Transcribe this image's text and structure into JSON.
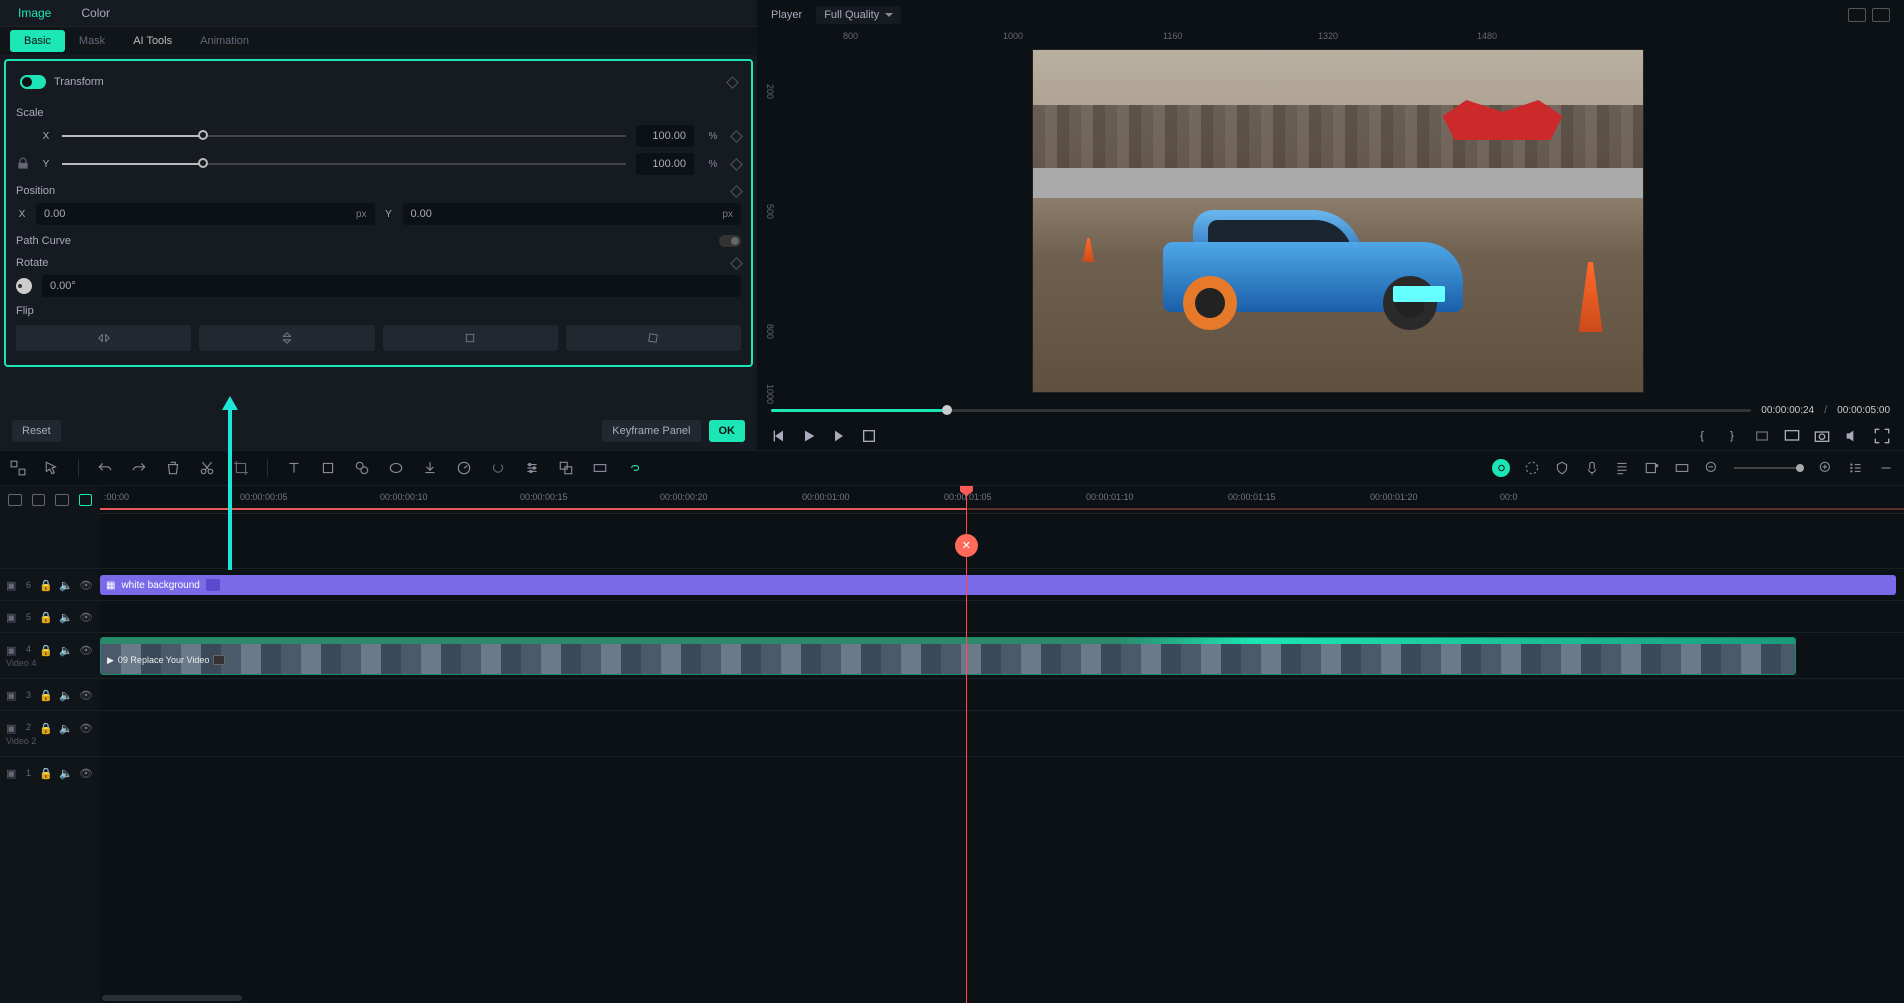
{
  "mainTabs": {
    "image": "Image",
    "color": "Color"
  },
  "subTabs": {
    "basic": "Basic",
    "mask": "Mask",
    "aiTools": "AI Tools",
    "animation": "Animation"
  },
  "inspector": {
    "transform": "Transform",
    "scale": "Scale",
    "scaleX": {
      "label": "X",
      "value": "100.00",
      "unit": "%"
    },
    "scaleY": {
      "label": "Y",
      "value": "100.00",
      "unit": "%"
    },
    "position": "Position",
    "posX": {
      "label": "X",
      "value": "0.00",
      "unit": "px"
    },
    "posY": {
      "label": "Y",
      "value": "0.00",
      "unit": "px"
    },
    "pathCurve": "Path Curve",
    "rotate": "Rotate",
    "rotateValue": "0.00°",
    "flip": "Flip"
  },
  "buttons": {
    "reset": "Reset",
    "keyframePanel": "Keyframe Panel",
    "ok": "OK"
  },
  "player": {
    "title": "Player",
    "quality": "Full Quality",
    "rulerH": [
      "800",
      "1000",
      "1160",
      "1320",
      "1480"
    ],
    "rulerV": [
      "200",
      "500",
      "800",
      "1000"
    ],
    "currentTime": "00:00:00:24",
    "totalTime": "00:00:05:00",
    "markL": "{",
    "markR": "}"
  },
  "timeline": {
    "ruler": [
      ":00:00",
      "00:00:00:05",
      "00:00:00:10",
      "00:00:00:15",
      "00:00:00:20",
      "00:00:01:00",
      "00:00:01:05",
      "00:00:01:10",
      "00:00:01:15",
      "00:00:01:20",
      "00:0"
    ],
    "playheadPercent": 48,
    "clip1": {
      "name": "white background"
    },
    "clip2": {
      "name": "09 Replace Your Video"
    },
    "tracks": {
      "t6": "6",
      "t5": "5",
      "t4": "4",
      "t4name": "Video 4",
      "t3": "3",
      "t2": "2",
      "t2name": "Video 2",
      "t1": "1"
    },
    "cutLabel": "✕"
  }
}
